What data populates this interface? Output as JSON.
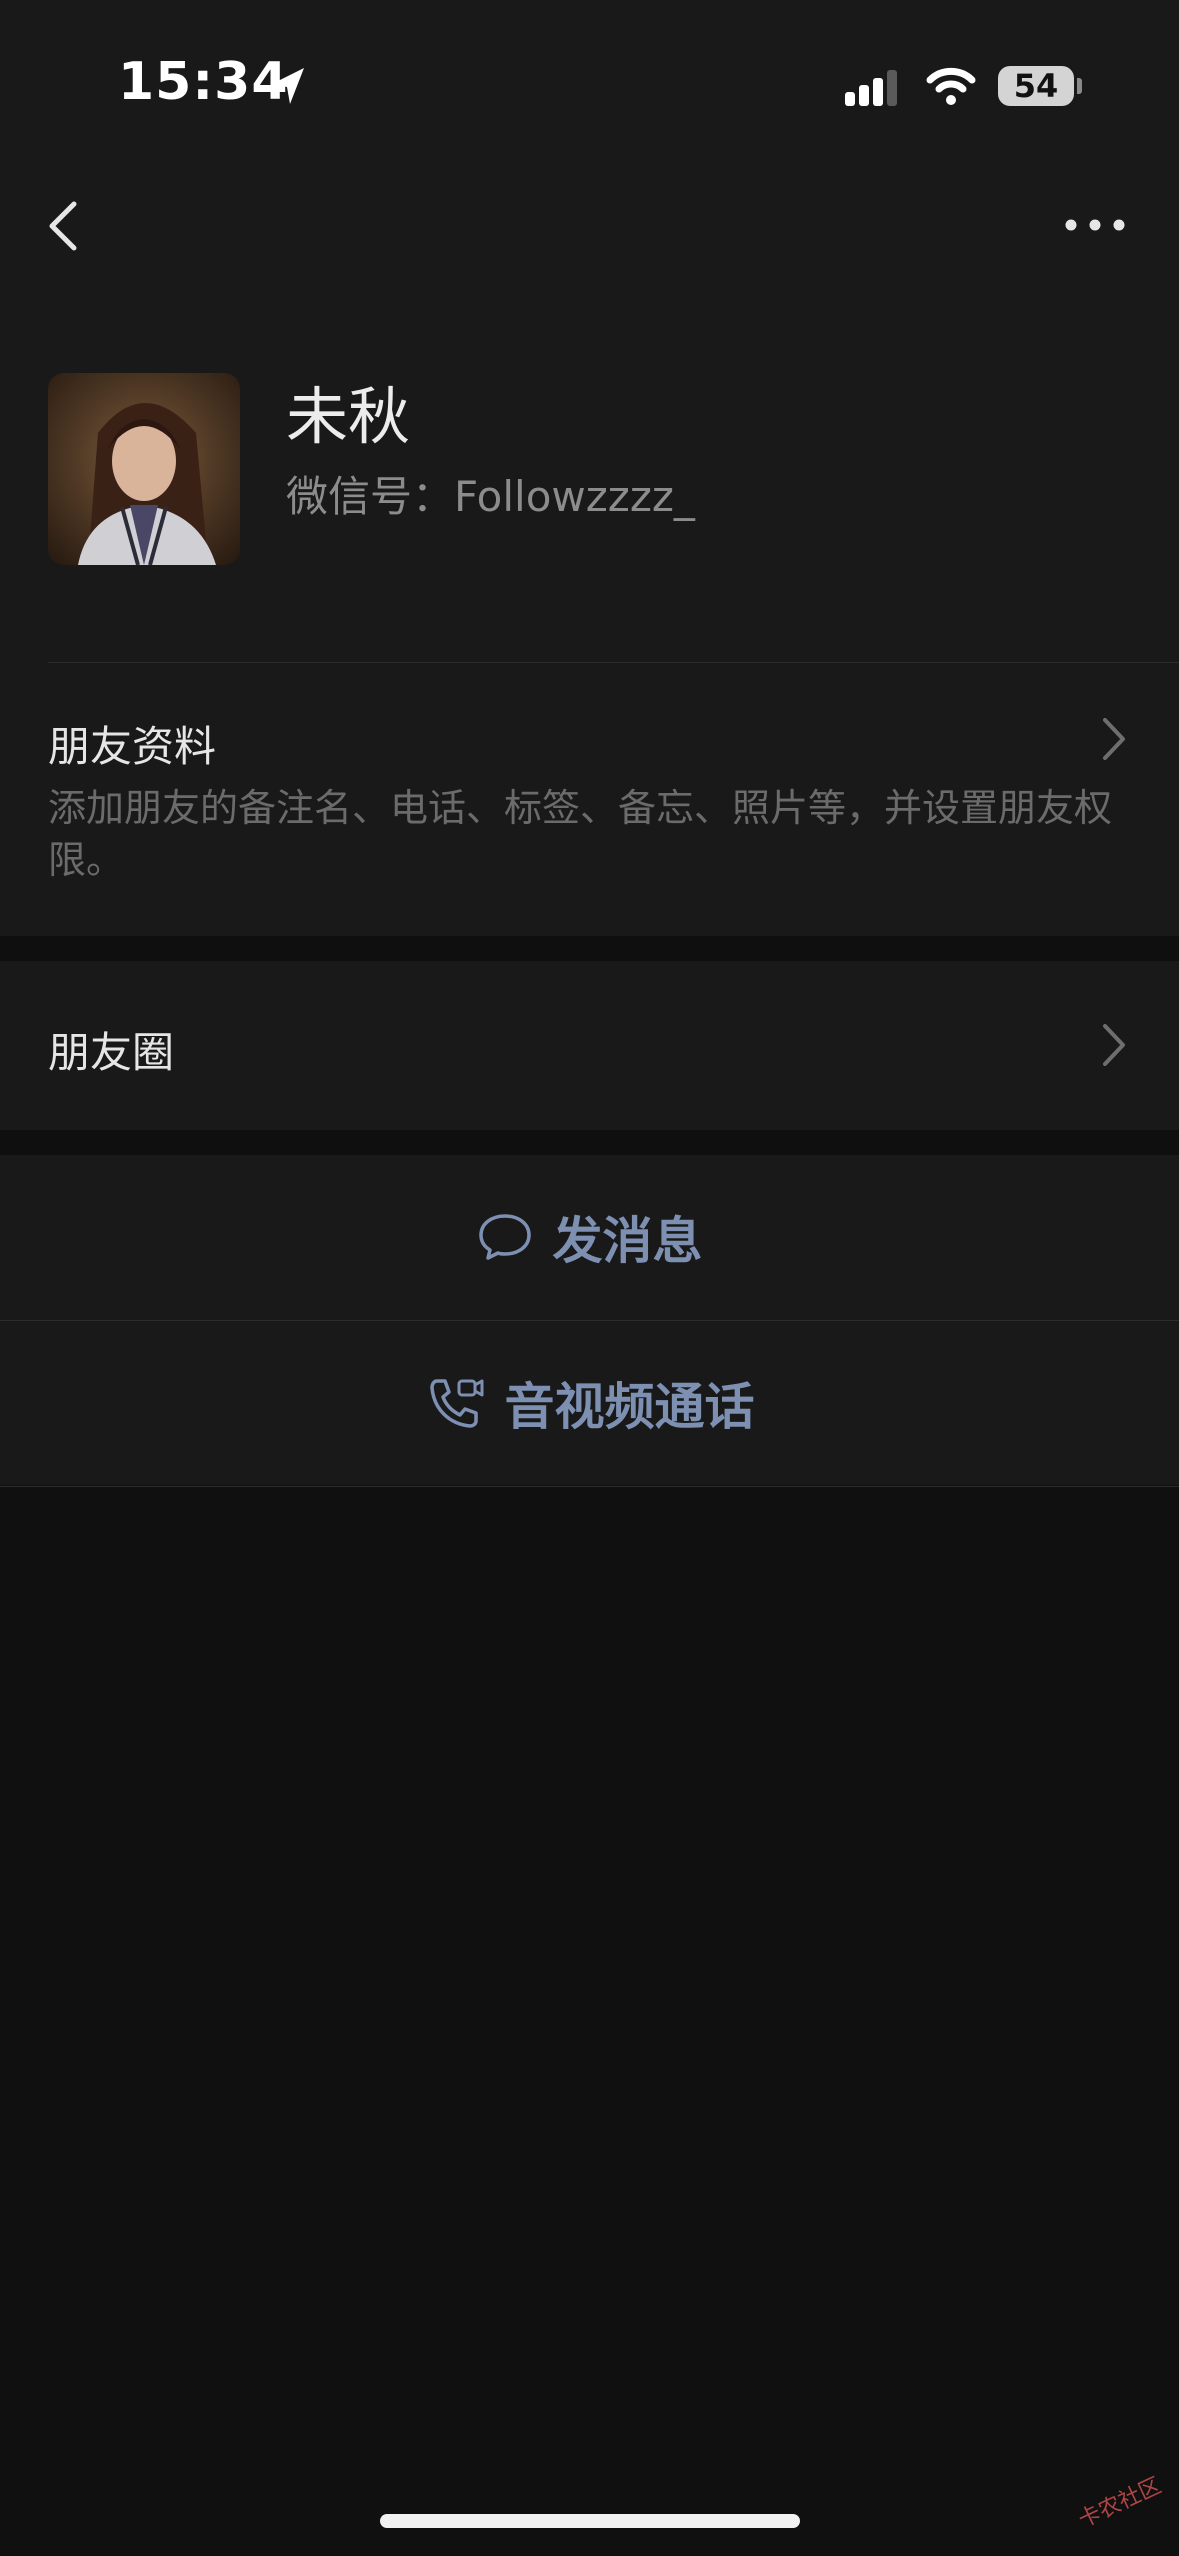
{
  "status_bar": {
    "time": "15:34",
    "battery": "54"
  },
  "profile": {
    "name": "未秋",
    "wechat_id": "微信号：Followzzzz_"
  },
  "friend_info": {
    "title": "朋友资料",
    "description": "添加朋友的备注名、电话、标签、备忘、照片等，并设置朋友权限。"
  },
  "moments": {
    "title": "朋友圈"
  },
  "actions": {
    "message": "发消息",
    "call": "音视频通话"
  },
  "watermark": "卡农社区",
  "colors": {
    "background": "#101010",
    "panel": "#191919",
    "link_blue": "#7d90b2",
    "secondary_text": "#8c8c8c"
  }
}
